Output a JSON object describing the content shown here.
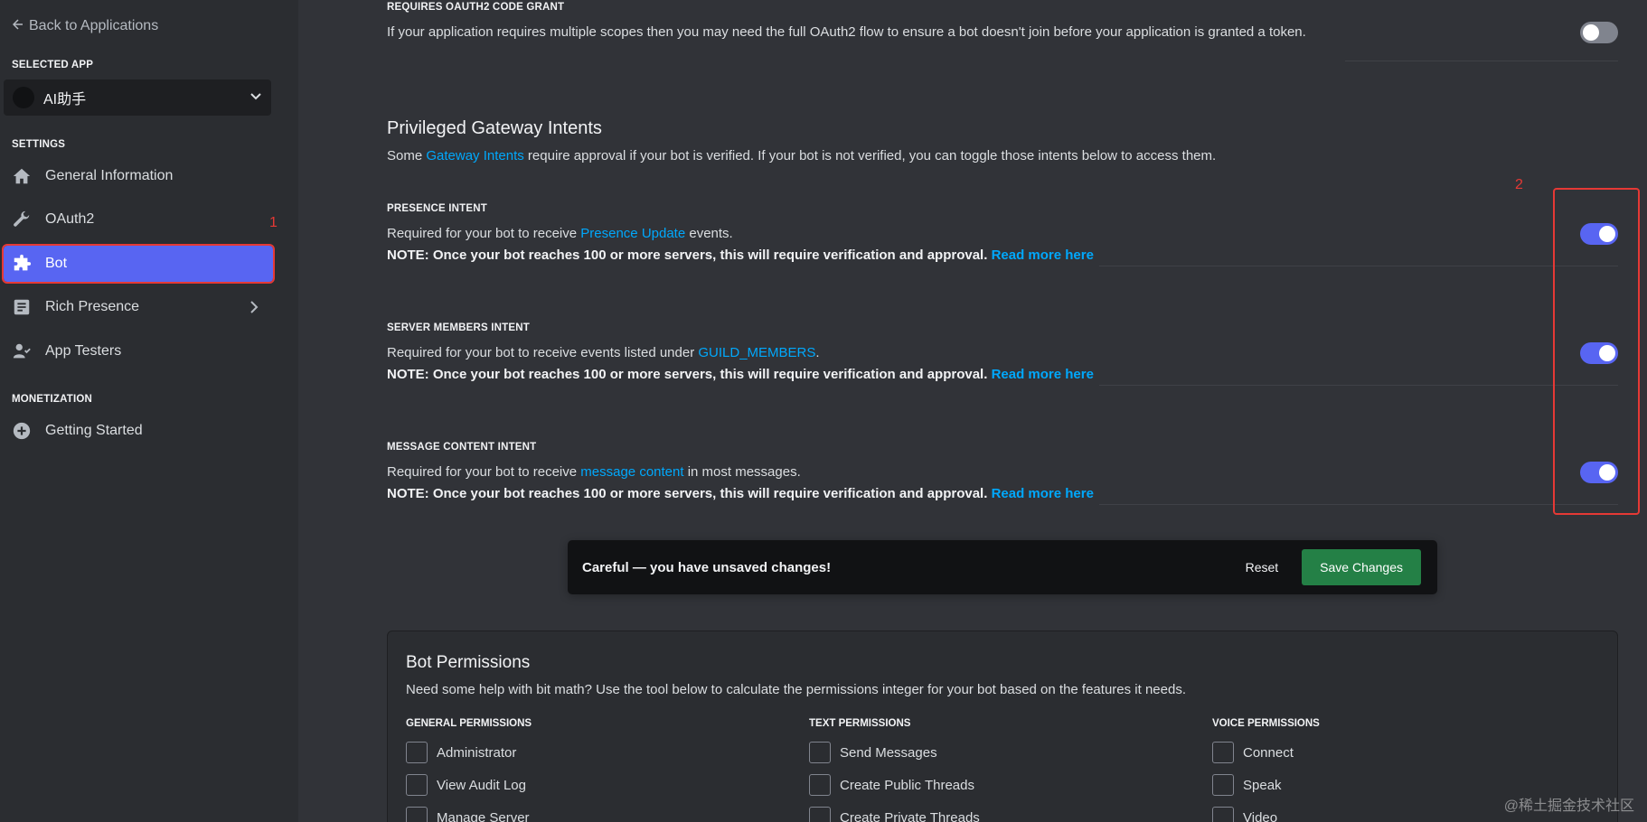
{
  "sidebar": {
    "back_label": "Back to Applications",
    "selected_app_label": "SELECTED APP",
    "app_name": "AI助手",
    "settings_label": "SETTINGS",
    "items": [
      {
        "label": "General Information",
        "icon": "home-icon"
      },
      {
        "label": "OAuth2",
        "icon": "wrench-icon"
      },
      {
        "label": "Bot",
        "icon": "puzzle-icon",
        "active": true
      },
      {
        "label": "Rich Presence",
        "icon": "document-icon"
      },
      {
        "label": "App Testers",
        "icon": "user-tester-icon"
      }
    ],
    "monetization_label": "MONETIZATION",
    "monetization_items": [
      {
        "label": "Getting Started",
        "icon": "plus-circle-icon"
      }
    ],
    "marker": "1"
  },
  "main": {
    "oauth_grant": {
      "caption": "REQUIRES OAUTH2 CODE GRANT",
      "desc": "If your application requires multiple scopes then you may need the full OAuth2 flow to ensure a bot doesn't join before your application is granted a token.",
      "enabled": false
    },
    "intents": {
      "title": "Privileged Gateway Intents",
      "desc_prefix": "Some ",
      "desc_link": "Gateway Intents",
      "desc_suffix": " require approval if your bot is verified. If your bot is not verified, you can toggle those intents below to access them.",
      "marker": "2",
      "items": [
        {
          "caption": "PRESENCE INTENT",
          "prefix": "Required for your bot to receive ",
          "link": "Presence Update",
          "suffix": " events.",
          "note": "NOTE: Once your bot reaches 100 or more servers, this will require verification and approval.",
          "note_link": "Read more here",
          "enabled": true
        },
        {
          "caption": "SERVER MEMBERS INTENT",
          "prefix": "Required for your bot to receive events listed under ",
          "link": "GUILD_MEMBERS",
          "suffix": ".",
          "note": "NOTE: Once your bot reaches 100 or more servers, this will require verification and approval.",
          "note_link": "Read more here",
          "enabled": true
        },
        {
          "caption": "MESSAGE CONTENT INTENT",
          "prefix": "Required for your bot to receive ",
          "link": "message content",
          "suffix": " in most messages.",
          "note": "NOTE: Once your bot reaches 100 or more servers, this will require verification and approval.",
          "note_link": "Read more here",
          "enabled": true
        }
      ]
    },
    "unsaved": {
      "message": "Careful — you have unsaved changes!",
      "reset_label": "Reset",
      "save_label": "Save Changes"
    },
    "permissions": {
      "title": "Bot Permissions",
      "desc": "Need some help with bit math? Use the tool below to calculate the permissions integer for your bot based on the features it needs.",
      "columns": [
        {
          "caption": "GENERAL PERMISSIONS",
          "items": [
            "Administrator",
            "View Audit Log",
            "Manage Server"
          ]
        },
        {
          "caption": "TEXT PERMISSIONS",
          "items": [
            "Send Messages",
            "Create Public Threads",
            "Create Private Threads"
          ]
        },
        {
          "caption": "VOICE PERMISSIONS",
          "items": [
            "Connect",
            "Speak",
            "Video"
          ]
        }
      ]
    }
  },
  "watermark": "@稀土掘金技术社区",
  "colors": {
    "accent": "#5865f2",
    "save": "#248046",
    "link": "#00a8fc",
    "annotation": "#e53935"
  }
}
